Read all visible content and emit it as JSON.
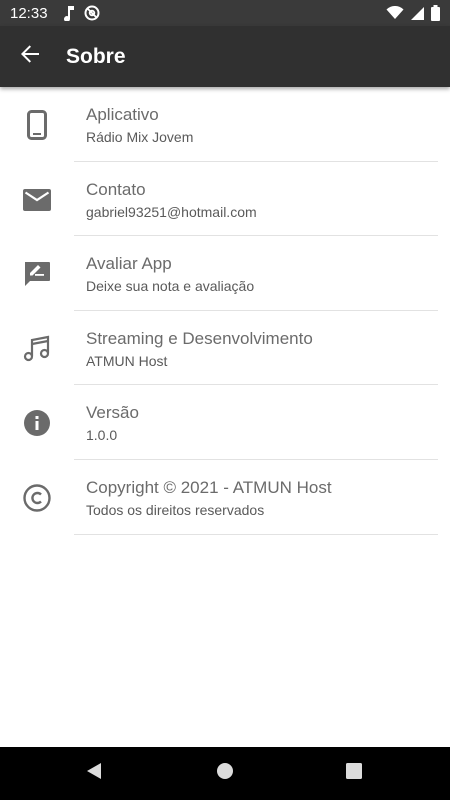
{
  "status_bar": {
    "time": "12:33",
    "left_icons": [
      "music-note-icon",
      "at-sign-icon"
    ],
    "right_icons": [
      "wifi-icon",
      "signal-icon",
      "battery-icon"
    ]
  },
  "app_bar": {
    "title": "Sobre",
    "back_icon": "arrow-back-icon",
    "background": "#303030"
  },
  "items": [
    {
      "icon": "phone-icon",
      "title": "Aplicativo",
      "subtitle": "Rádio Mix Jovem"
    },
    {
      "icon": "mail-icon",
      "title": "Contato",
      "subtitle": "gabriel93251@hotmail.com"
    },
    {
      "icon": "rate-review-icon",
      "title": "Avaliar App",
      "subtitle": "Deixe sua nota e avaliação"
    },
    {
      "icon": "music-note-icon",
      "title": "Streaming e Desenvolvimento",
      "subtitle": "ATMUN Host"
    },
    {
      "icon": "info-icon",
      "title": "Versão",
      "subtitle": "1.0.0"
    },
    {
      "icon": "copyright-icon",
      "title": "Copyright © 2021 - ATMUN Host",
      "subtitle": "Todos os direitos reservados"
    }
  ],
  "nav_bar": {
    "buttons": [
      "nav-back-icon",
      "nav-home-icon",
      "nav-recents-icon"
    ]
  },
  "colors": {
    "icon": "#6b6b6b",
    "title_text": "#6b6b6b",
    "subtitle_text": "#5a5a5a",
    "divider": "#e2e2e2"
  }
}
